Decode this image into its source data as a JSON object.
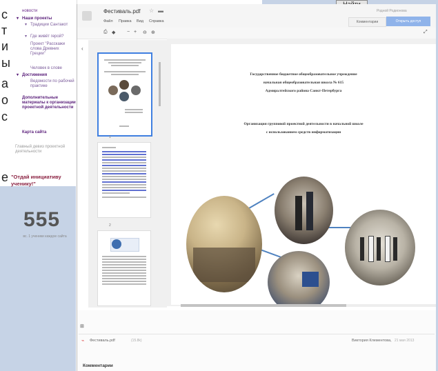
{
  "background": {
    "edge_letters": [
      "с",
      "т",
      "и",
      "ы",
      "а",
      "о",
      "с",
      "е"
    ],
    "find_button": "Найти"
  },
  "sidebar": {
    "items": [
      {
        "label": "новости"
      },
      {
        "label": "Наши проекты"
      },
      {
        "label": "Традиции Сантакот"
      },
      {
        "label": "Где живёт герой?"
      },
      {
        "label": "Проект \"Расскажи слова Древних Греции\""
      },
      {
        "label": "Человек в слове"
      },
      {
        "label": "Достижения"
      },
      {
        "label": "Ведомости по рабочей практике"
      },
      {
        "label": "Дополнительные материалы к организации проектной деятельности"
      },
      {
        "label": "Карта сайта"
      },
      {
        "label": "Главный девиз проектной деятельности"
      }
    ],
    "quote": "\"Отдай инициативу ученику!\"",
    "counter": "555",
    "counter_caption": "вс. 1 ученики каждое сайта"
  },
  "viewer": {
    "title": "Фестиваль.pdf",
    "menu": [
      "Файл",
      "Правка",
      "Вид",
      "Справка"
    ],
    "user": "Родной Родионова",
    "comments_button": "Комментарии",
    "share_button": "Открыть доступ",
    "toolbar": [
      "⎙",
      "◆",
      "−",
      "+",
      "⊖",
      "⊕"
    ],
    "thumb_numbers": [
      "1",
      "2"
    ],
    "page_text": {
      "org_line1": "Государственное бюджетное общеобразовательное учреждение",
      "org_line2": "начальная общеобразовательная школа № 615",
      "org_line3": "Адмиралтейского района Санкт-Петербурга",
      "topic_line1": "Организация групповой проектной деятельности в начальной школе",
      "topic_line2": "с использованием средств информатизации"
    }
  },
  "attachment": {
    "name": "Фестиваль.pdf",
    "size": "(15.8k)",
    "author": "Виктория Клементова,",
    "date": "21 мая 2013"
  },
  "comments_heading": "Комментарии",
  "colors": {
    "accent_blue": "#3f7fe0",
    "share_blue": "#8fb3ea",
    "sidebar_link": "#6b2a8a",
    "quote_color": "#8a2040",
    "connector": "#4f82c0"
  },
  "icons": {
    "drive_logo": "drive-logo-icon",
    "star": "star-icon",
    "folder": "folder-icon",
    "pdf": "pdf-icon"
  }
}
